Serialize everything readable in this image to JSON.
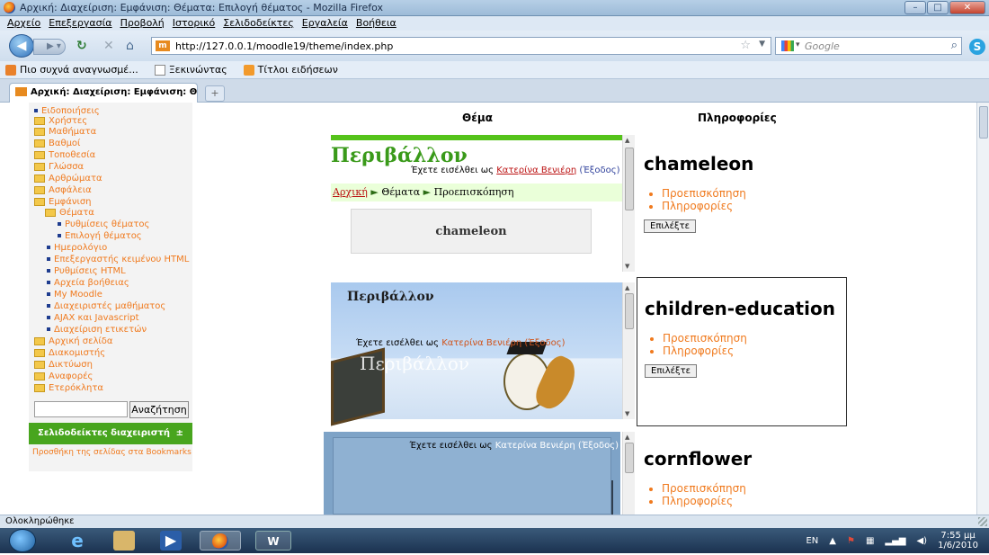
{
  "window": {
    "title": "Αρχική: Διαχείριση: Εμφάνιση: Θέματα: Επιλογή θέματος - Mozilla Firefox",
    "minimize": "–",
    "maximize": "□",
    "close": "✕"
  },
  "menu": [
    "Αρχείο",
    "Επεξεργασία",
    "Προβολή",
    "Ιστορικό",
    "Σελιδοδείκτες",
    "Εργαλεία",
    "Βοήθεια"
  ],
  "nav": {
    "url": "http://127.0.0.1/moodle19/theme/index.php",
    "search_placeholder": "Google",
    "site_icon": "m"
  },
  "bookmarks": [
    "Πιο συχνά αναγνωσμέ...",
    "Ξεκινώντας",
    "Τίτλοι ειδήσεων"
  ],
  "tab": {
    "label": "Αρχική: Διαχείριση: Εμφάνιση: Θέμα...",
    "close": "×",
    "new_tab": "+"
  },
  "sidebar": {
    "items": [
      {
        "label": "Ειδοποιήσεις",
        "kind": "bullet"
      },
      {
        "label": "Χρήστες",
        "kind": "folder"
      },
      {
        "label": "Μαθήματα",
        "kind": "folder"
      },
      {
        "label": "Βαθμοί",
        "kind": "folder"
      },
      {
        "label": "Τοποθεσία",
        "kind": "folder"
      },
      {
        "label": "Γλώσσα",
        "kind": "folder"
      },
      {
        "label": "Αρθρώματα",
        "kind": "folder"
      },
      {
        "label": "Ασφάλεια",
        "kind": "folder"
      },
      {
        "label": "Εμφάνιση",
        "kind": "folder"
      },
      {
        "label": "Θέματα",
        "kind": "folder"
      },
      {
        "label": "Ρυθμίσεις θέματος",
        "kind": "bullet"
      },
      {
        "label": "Επιλογή θέματος",
        "kind": "bullet"
      },
      {
        "label": "Ημερολόγιο",
        "kind": "bullet"
      },
      {
        "label": "Επεξεργαστής κειμένου HTML",
        "kind": "bullet"
      },
      {
        "label": "Ρυθμίσεις HTML",
        "kind": "bullet"
      },
      {
        "label": "Αρχεία βοήθειας",
        "kind": "bullet"
      },
      {
        "label": "My Moodle",
        "kind": "bullet"
      },
      {
        "label": "Διαχειριστές μαθήματος",
        "kind": "bullet"
      },
      {
        "label": "AJAX και Javascript",
        "kind": "bullet"
      },
      {
        "label": "Διαχείριση ετικετών",
        "kind": "bullet"
      },
      {
        "label": "Αρχική σελίδα",
        "kind": "folder"
      },
      {
        "label": "Διακομιστής",
        "kind": "folder"
      },
      {
        "label": "Δικτύωση",
        "kind": "folder"
      },
      {
        "label": "Αναφορές",
        "kind": "folder"
      },
      {
        "label": "Ετερόκλητα",
        "kind": "folder"
      }
    ],
    "search_button": "Αναζήτηση",
    "bookmarks_block_title": "Σελιδοδείκτες διαχειριστή",
    "bookmarks_block_arrow": "±",
    "bookmarks_link": "Προσθήκη της σελίδας στα Bookmarks"
  },
  "columns": {
    "theme": "Θέμα",
    "info": "Πληροφορίες"
  },
  "themes": [
    {
      "preview_heading": "Περιβάλλον",
      "login_prefix": "Έχετε εισέλθει ως",
      "login_user": "Κατερίνα Βενιέρη",
      "logout": "(Έξοδος)",
      "breadcrumb": [
        "Αρχική",
        "Θέματα",
        "Προεπισκόπηση"
      ],
      "breadcrumb_sep": "►",
      "preview_box": "chameleon",
      "name": "chameleon",
      "links": [
        "Προεπισκόπηση",
        "Πληροφορίες"
      ],
      "select": "Επιλέξτε"
    },
    {
      "preview_heading": "Περιβάλλον",
      "login_prefix": "Έχετε εισέλθει ως",
      "login_user": "Κατερίνα Βενιέρη",
      "logout": "(Έξοδος)",
      "watermark": "Περιβάλλον",
      "name": "children-education",
      "links": [
        "Προεπισκόπηση",
        "Πληροφορίες"
      ],
      "select": "Επιλέξτε"
    },
    {
      "login_prefix": "Έχετε εισέλθει ως",
      "login_user": "Κατερίνα Βενιέρη",
      "logout": "(Έξοδος)",
      "name": "cornflower",
      "links": [
        "Προεπισκόπηση",
        "Πληροφορίες"
      ]
    }
  ],
  "status": "Ολοκληρώθηκε",
  "taskbar": {
    "lang": "EN",
    "time": "7:55 μμ",
    "date": "1/6/2010"
  }
}
